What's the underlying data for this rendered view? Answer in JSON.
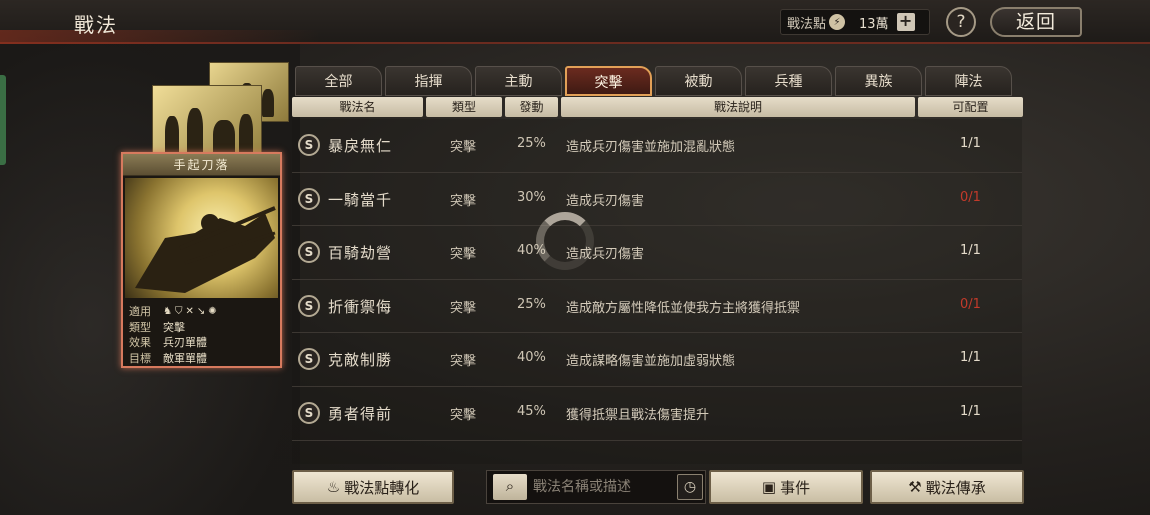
{
  "header": {
    "title": "戰法",
    "points_label": "戰法點",
    "points_value": "13萬",
    "plus_symbol": "+",
    "help_symbol": "?",
    "back_label": "返回"
  },
  "card": {
    "title": "手起刀落",
    "rows": [
      {
        "key": "適用",
        "value": ""
      },
      {
        "key": "類型",
        "value": "突擊"
      },
      {
        "key": "效果",
        "value": "兵刃單體"
      },
      {
        "key": "目標",
        "value": "敵軍單體"
      }
    ],
    "troop_icons": [
      "cavalry-icon",
      "shield-icon",
      "bow-icon",
      "spear-icon",
      "siege-icon"
    ]
  },
  "tabs": [
    {
      "label": "全部",
      "active": false
    },
    {
      "label": "指揮",
      "active": false
    },
    {
      "label": "主動",
      "active": false
    },
    {
      "label": "突擊",
      "active": true
    },
    {
      "label": "被動",
      "active": false
    },
    {
      "label": "兵種",
      "active": false
    },
    {
      "label": "異族",
      "active": false
    },
    {
      "label": "陣法",
      "active": false
    }
  ],
  "table": {
    "headers": [
      "戰法名",
      "類型",
      "發動",
      "戰法說明",
      "可配置"
    ],
    "rows": [
      {
        "grade": "S",
        "name": "暴戾無仁",
        "type": "突擊",
        "rate": "25%",
        "desc": "造成兵刃傷害並施加混亂狀態",
        "count": "1/1",
        "red": false
      },
      {
        "grade": "S",
        "name": "一騎當千",
        "type": "突擊",
        "rate": "30%",
        "desc": "造成兵刃傷害",
        "count": "0/1",
        "red": true
      },
      {
        "grade": "S",
        "name": "百騎劫營",
        "type": "突擊",
        "rate": "40%",
        "desc": "造成兵刃傷害",
        "count": "1/1",
        "red": false
      },
      {
        "grade": "S",
        "name": "折衝禦侮",
        "type": "突擊",
        "rate": "25%",
        "desc": "造成敵方屬性降低並使我方主將獲得抵禦",
        "count": "0/1",
        "red": true
      },
      {
        "grade": "S",
        "name": "克敵制勝",
        "type": "突擊",
        "rate": "40%",
        "desc": "造成謀略傷害並施加虛弱狀態",
        "count": "1/1",
        "red": false
      },
      {
        "grade": "S",
        "name": "勇者得前",
        "type": "突擊",
        "rate": "45%",
        "desc": "獲得抵禦且戰法傷害提升",
        "count": "1/1",
        "red": false
      }
    ]
  },
  "bottom": {
    "convert_label": "戰法點轉化",
    "search_placeholder": "戰法名稱或描述",
    "event_label": "事件",
    "inherit_label": "戰法傳承"
  }
}
